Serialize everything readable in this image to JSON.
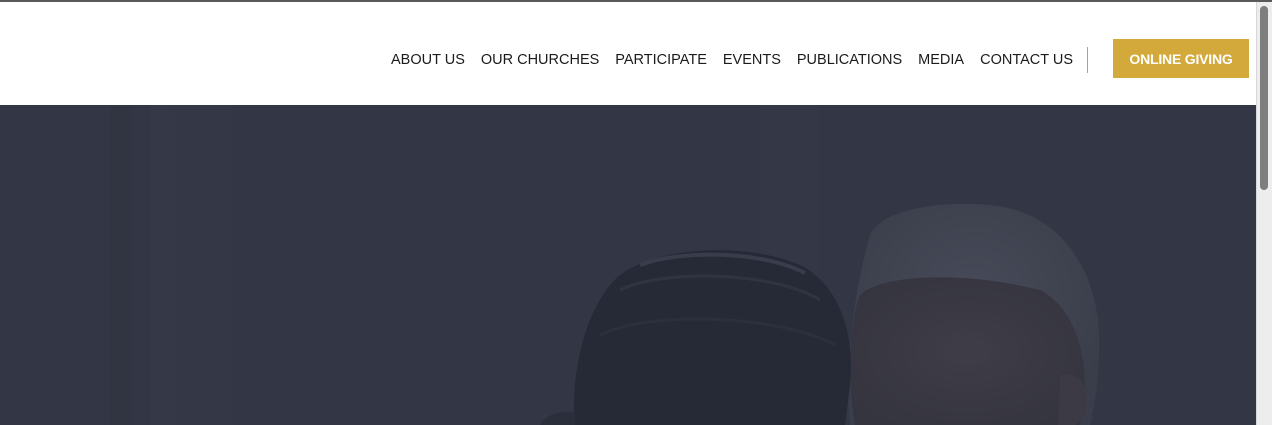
{
  "header": {
    "nav_items": [
      "ABOUT US",
      "OUR CHURCHES",
      "PARTICIPATE",
      "EVENTS",
      "PUBLICATIONS",
      "MEDIA",
      "CONTACT US"
    ],
    "cta_label": "ONLINE GIVING"
  },
  "hero": {
    "overlay_color": "#323645",
    "image_subject": "photo of two people embracing"
  },
  "colors": {
    "accent": "#d3a93b",
    "nav_text": "#1b1b1b",
    "header_background": "#ffffff"
  },
  "scrollbar": {
    "position_fraction": 0
  }
}
